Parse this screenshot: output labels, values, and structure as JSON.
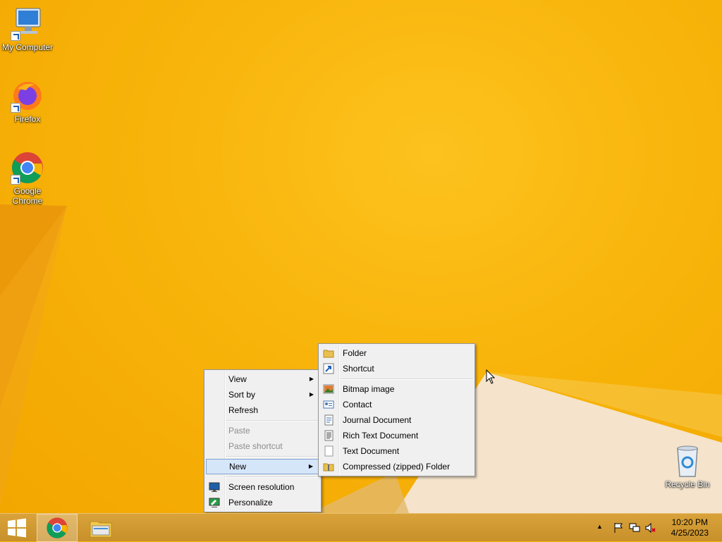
{
  "desktop": {
    "icons": [
      {
        "label": "My Computer",
        "icon": "computer-icon"
      },
      {
        "label": "Firefox",
        "icon": "firefox-icon"
      },
      {
        "label": "Google Chrome",
        "icon": "chrome-icon"
      },
      {
        "label": "Recycle Bin",
        "icon": "recycle-bin-icon"
      }
    ]
  },
  "context_menu": {
    "items": [
      {
        "label": "View",
        "submenu": true
      },
      {
        "label": "Sort by",
        "submenu": true
      },
      {
        "label": "Refresh"
      },
      {
        "label": "Paste",
        "disabled": true
      },
      {
        "label": "Paste shortcut",
        "disabled": true
      },
      {
        "label": "New",
        "submenu": true,
        "highlighted": true
      },
      {
        "label": "Screen resolution",
        "icon": "screen-resolution-icon"
      },
      {
        "label": "Personalize",
        "icon": "personalize-icon"
      }
    ],
    "submenu_arrow": "▶"
  },
  "new_submenu": {
    "items": [
      {
        "label": "Folder",
        "icon": "folder-icon"
      },
      {
        "label": "Shortcut",
        "icon": "shortcut-icon"
      },
      {
        "label": "Bitmap image",
        "icon": "bitmap-icon"
      },
      {
        "label": "Contact",
        "icon": "contact-icon"
      },
      {
        "label": "Journal Document",
        "icon": "journal-icon"
      },
      {
        "label": "Rich Text Document",
        "icon": "rich-text-icon"
      },
      {
        "label": "Text Document",
        "icon": "text-document-icon"
      },
      {
        "label": "Compressed (zipped) Folder",
        "icon": "zip-folder-icon"
      }
    ]
  },
  "taskbar": {
    "clock_time": "10:20 PM",
    "clock_date": "4/25/2023",
    "tray_expand": "▲"
  },
  "colors": {
    "wallpaper": "#F7B500",
    "taskbar": "#C8902A",
    "menu_bg": "#F0F0F0",
    "menu_highlight": "#D5E6F8"
  }
}
